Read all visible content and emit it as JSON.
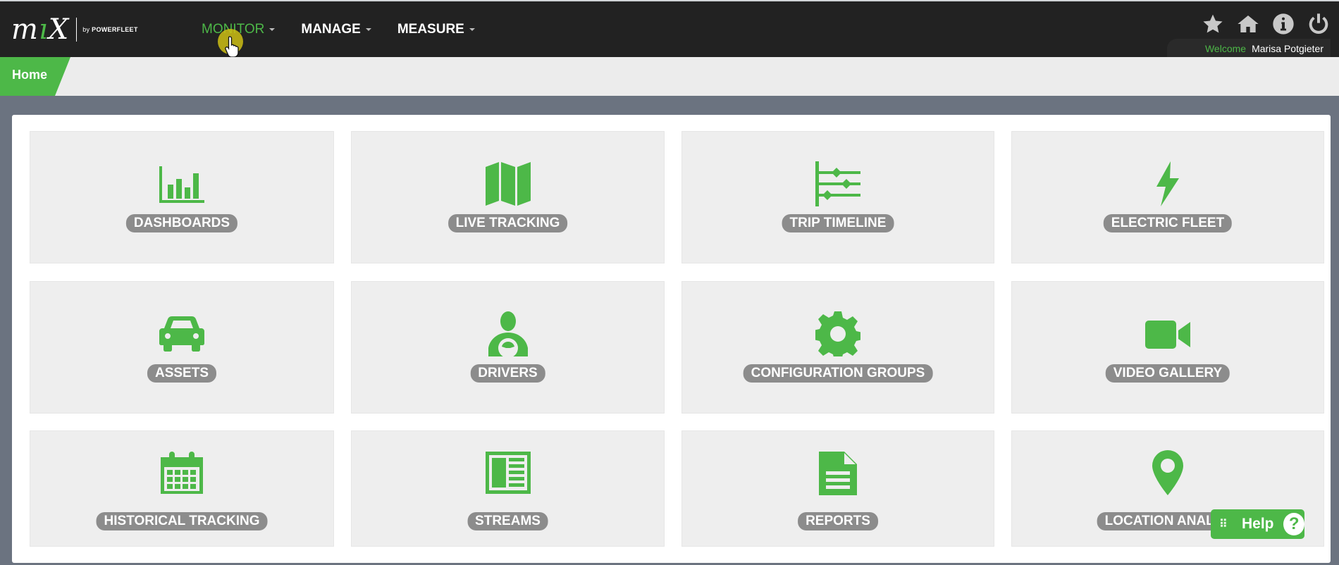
{
  "logo": {
    "mark": "mix",
    "tagline_prefix": "by",
    "tagline_brand": "POWERFLEET"
  },
  "nav": [
    {
      "label": "MONITOR",
      "active": true
    },
    {
      "label": "MANAGE",
      "active": false
    },
    {
      "label": "MEASURE",
      "active": false
    }
  ],
  "top_icons": [
    "star-icon",
    "home-icon",
    "info-icon",
    "power-icon"
  ],
  "welcome": {
    "greeting": "Welcome",
    "user": "Marisa Potgieter"
  },
  "breadcrumb": {
    "home": "Home"
  },
  "tiles": [
    {
      "label": "DASHBOARDS",
      "icon": "bar-chart-icon"
    },
    {
      "label": "LIVE TRACKING",
      "icon": "map-icon"
    },
    {
      "label": "TRIP TIMELINE",
      "icon": "timeline-sliders-icon"
    },
    {
      "label": "ELECTRIC FLEET",
      "icon": "lightning-bolt-icon"
    },
    {
      "label": "ASSETS",
      "icon": "car-icon"
    },
    {
      "label": "DRIVERS",
      "icon": "driver-icon"
    },
    {
      "label": "CONFIGURATION GROUPS",
      "icon": "gear-icon"
    },
    {
      "label": "VIDEO GALLERY",
      "icon": "video-camera-icon"
    },
    {
      "label": "HISTORICAL TRACKING",
      "icon": "calendar-icon"
    },
    {
      "label": "STREAMS",
      "icon": "stream-columns-icon"
    },
    {
      "label": "REPORTS",
      "icon": "document-icon"
    },
    {
      "label": "LOCATION ANALYS",
      "icon": "map-pin-icon"
    }
  ],
  "help": {
    "label": "Help",
    "symbol": "?",
    "grip": "⠿"
  },
  "colors": {
    "brand_green": "#4db848",
    "topbar": "#222222",
    "tile_bg": "#eeeeee",
    "label_bg": "#8c8c8c"
  }
}
